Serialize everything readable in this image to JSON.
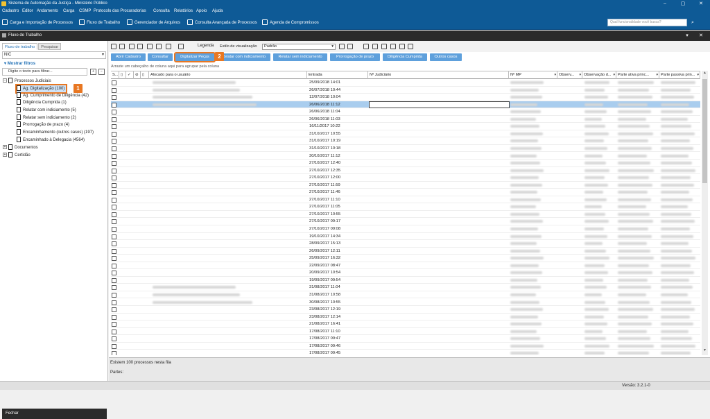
{
  "title": "Sistema de Automação da Justiça - Ministério Público",
  "window_controls": [
    "–",
    "▢",
    "✕"
  ],
  "menu": [
    "Cadastro",
    "Editor",
    "Andamento",
    "Carga",
    "CSMP",
    "Protocolo das Procuradorias",
    "Consulta",
    "Relatórios",
    "Apoio",
    "Ajuda"
  ],
  "toolbar": [
    "Carga e Importação de Processos",
    "Fluxo de Trabalho",
    "Gerenciador de Arquivos",
    "Consulta Avançada de Processos",
    "Agenda de Compromissos"
  ],
  "search": {
    "placeholder": "Qual funcionalidade você busca?"
  },
  "panel": {
    "title": "Fluxo de Trabalho",
    "pin": "▾",
    "close": "✕"
  },
  "left": {
    "tabs": [
      "Fluxo de trabalho",
      "Pesquisar"
    ],
    "combo": "NIC",
    "show_filters": "Mostrar filtros",
    "filter_placeholder": "Digite o texto para filtrar...",
    "tree": {
      "root": "Processos Judiciais",
      "children": [
        "Ag. Digitalização (100)",
        "Ag. Cumprimento de Diligência (42)",
        "Diligência Cumprida (1)",
        "Relatar com indiciamento (5)",
        "Relatar sem indiciamento (2)",
        "Prorrogação de prazo (4)",
        "Encaminhamento (outros casos) (197)",
        "Encaminhado à Delegacia (4564)"
      ],
      "others": [
        "Documentos",
        "Certidão"
      ]
    },
    "close": "Fechar"
  },
  "badges": [
    "1",
    "2"
  ],
  "right": {
    "legend": "Legenda",
    "style_label": "Estilo de visualização",
    "style_value": "Padrão",
    "actions": [
      "Abrir Cadastro",
      "Consultar",
      "Digitalizar Peças",
      "Relatar com indiciamento",
      "Relatar sem indiciamento",
      "Prorrogação de prazo",
      "Diligência Cumprida",
      "Outros casos"
    ],
    "group_hint": "Arraste um cabeçalho de coluna aqui para agrupar pela coluna",
    "columns": [
      "S...",
      "Alocado para o usuário",
      "Entrada",
      "Nº Judiciário",
      "Nº MP",
      "Observ...",
      "Observação d...",
      "Parte ativa princ...",
      "Parte passiva prin..."
    ],
    "dates": [
      "25/09/2018 14:01",
      "26/07/2018 10:44",
      "12/07/2018 10:04",
      "26/06/2018 11:12",
      "26/06/2018 11:04",
      "26/06/2018 11:03",
      "16/11/2017 10:22",
      "31/10/2017 10:55",
      "31/10/2017 10:19",
      "31/10/2017 10:18",
      "30/10/2017 11:12",
      "27/10/2017 12:40",
      "27/10/2017 12:35",
      "27/10/2017 12:00",
      "27/10/2017 11:59",
      "27/10/2017 11:46",
      "27/10/2017 11:10",
      "27/10/2017 11:05",
      "27/10/2017 10:55",
      "27/10/2017 09:17",
      "27/10/2017 09:08",
      "19/10/2017 14:34",
      "28/09/2017 15:13",
      "26/09/2017 12:11",
      "25/09/2017 16:32",
      "22/09/2017 08:47",
      "20/09/2017 10:54",
      "19/09/2017 09:54",
      "31/08/2017 11:04",
      "31/08/2017 10:58",
      "30/08/2017 10:55",
      "23/08/2017 12:19",
      "23/08/2017 12:14",
      "21/08/2017 16:41",
      "17/08/2017 11:10",
      "17/08/2017 09:47",
      "17/08/2017 09:46",
      "17/08/2017 09:45"
    ],
    "selected_row": 3,
    "footer_count": "Existem 100 processos nesta fila",
    "footer_parts": "Partes:"
  },
  "version": "Versão: 3.2.1-0",
  "colors": {
    "blue": "#0e5a96",
    "accent": "#e87722",
    "button": "#5ea0dc"
  }
}
